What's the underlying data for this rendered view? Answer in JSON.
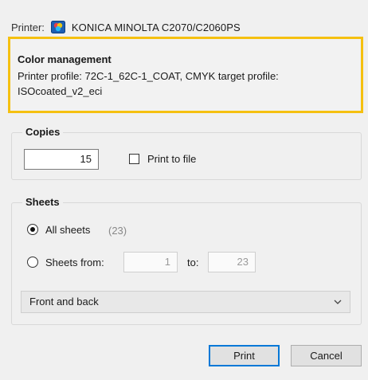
{
  "printer": {
    "label": "Printer:",
    "name": "KONICA MINOLTA C2070/C2060PS",
    "icon": "color-printer-icon"
  },
  "color_management": {
    "title": "Color management",
    "line1": "Printer profile: 72C-1_62C-1_COAT, CMYK target profile:",
    "line2": "ISOcoated_v2_eci",
    "highlight_color": "#f5c010"
  },
  "copies": {
    "title": "Copies",
    "value": "15",
    "print_to_file_label": "Print to file",
    "print_to_file_checked": false
  },
  "sheets": {
    "title": "Sheets",
    "all_sheets_label": "All sheets",
    "all_sheets_count": "(23)",
    "sheets_from_label": "Sheets from:",
    "from_value": "1",
    "to_label": "to:",
    "to_value": "23",
    "selected": "all"
  },
  "duplex": {
    "selected": "Front and back",
    "icon": "chevron-down-icon"
  },
  "buttons": {
    "print": "Print",
    "cancel": "Cancel"
  },
  "colors": {
    "accent": "#0078d7",
    "background": "#f0f0f0"
  }
}
